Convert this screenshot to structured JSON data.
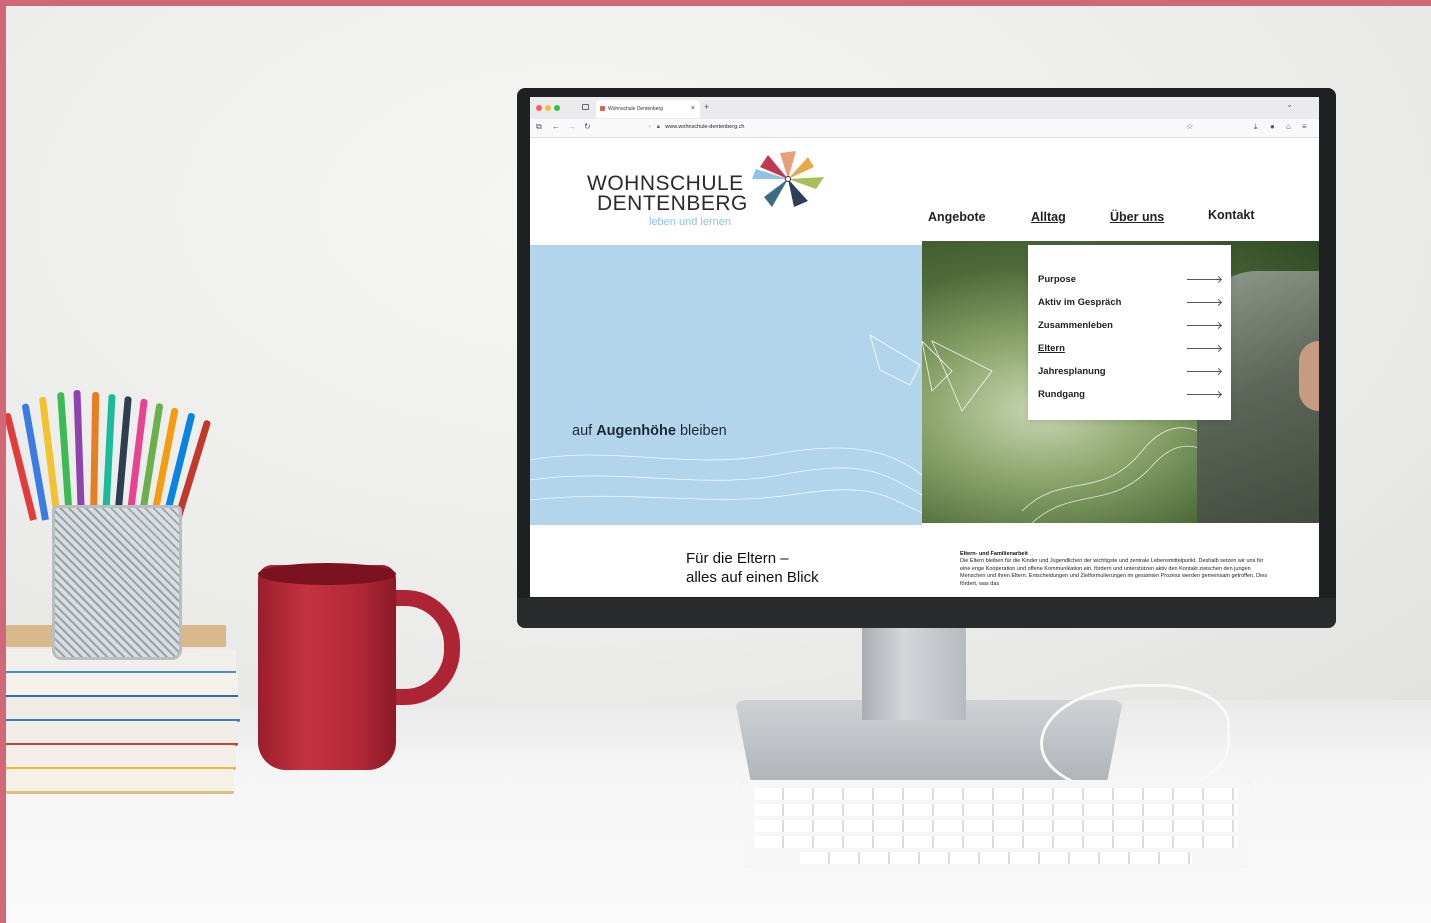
{
  "browser": {
    "tab_title": "Wohnschule Dentenberg",
    "tab_close": "×",
    "tab_add": "+",
    "url": "www.wohnschule-dentenberg.ch",
    "traffic_colors": [
      "#ff5f57",
      "#febc2e",
      "#28c840"
    ]
  },
  "site": {
    "logo": {
      "line1": "WOHNSCHULE",
      "line2": "DENTENBERG",
      "tagline": "leben und lernen"
    },
    "nav": [
      {
        "label": "Angebote"
      },
      {
        "label": "Alltag"
      },
      {
        "label": "Über uns"
      },
      {
        "label": "Kontakt"
      }
    ],
    "hero": {
      "tagline_pre": "auf ",
      "tagline_bold": "Augenhöhe",
      "tagline_post": " bleiben"
    },
    "dropdown": [
      {
        "label": "Purpose"
      },
      {
        "label": "Aktiv im Gespräch"
      },
      {
        "label": "Zusammenleben"
      },
      {
        "label": "Eltern"
      },
      {
        "label": "Jahresplanung"
      },
      {
        "label": "Rundgang"
      }
    ],
    "section": {
      "title_line1": "Für die Eltern –",
      "title_line2": "alles auf einen Blick",
      "heading": "Eltern- und Familienarbeit",
      "text": "Die Eltern bleiben für die Kinder und Jugendlichen der wichtigste und zentrale Lebensmittelpunkt. Deshalb setzen wir uns für eine enge Kooperation und offene Kommunikation ein, fördern und unterstützen aktiv den Kontakt zwischen den jungen Menschen und ihren Eltern. Entscheidungen und Zielformulierungen im gesamten Prozess werden gemeinsam getroffen. Dies fördert, was das"
    },
    "colors": {
      "hero_blue": "#b3d5ec",
      "tagline_blue": "#8ec3e4"
    }
  },
  "icons": [
    "back-arrow-icon",
    "forward-arrow-icon",
    "reload-icon",
    "sidebar-icon",
    "shield-icon",
    "lock-icon",
    "star-icon",
    "download-icon",
    "account-icon",
    "extensions-icon",
    "menu-icon",
    "chevron-down-icon",
    "pinwheel-logo-icon"
  ]
}
